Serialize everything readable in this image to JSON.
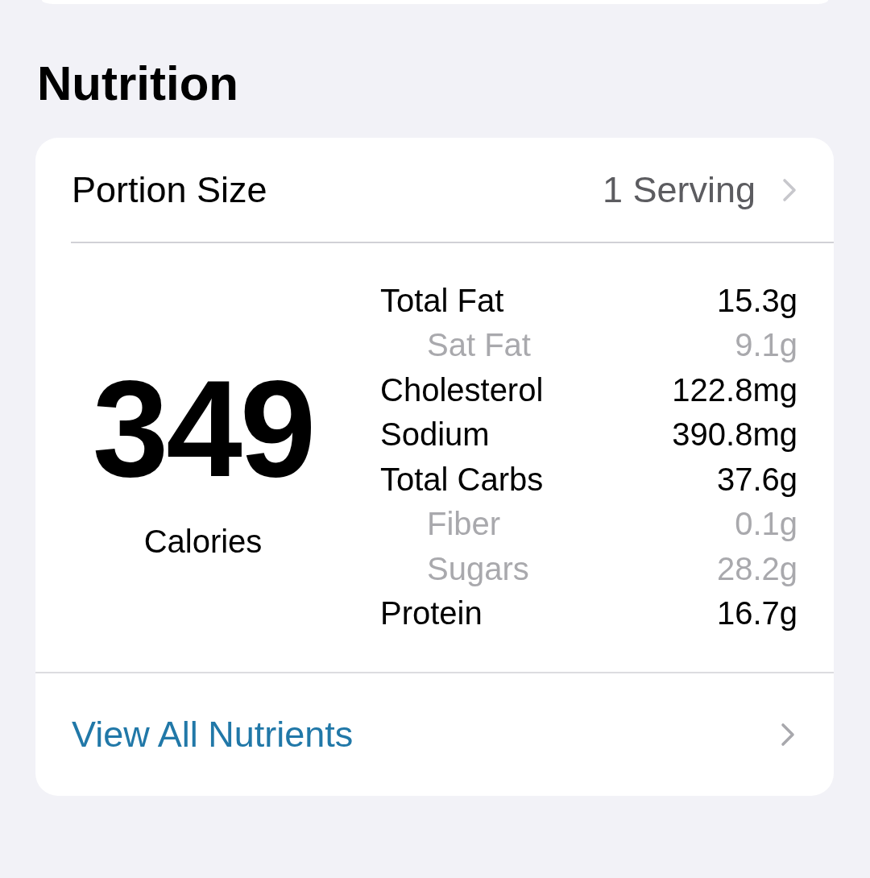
{
  "section_title": "Nutrition",
  "portion": {
    "label": "Portion Size",
    "value": "1 Serving"
  },
  "calories": {
    "value": "349",
    "label": "Calories"
  },
  "nutrients": [
    {
      "name": "Total Fat",
      "amount": "15.3g",
      "children": [
        {
          "name": "Sat Fat",
          "amount": "9.1g"
        }
      ]
    },
    {
      "name": "Cholesterol",
      "amount": "122.8mg"
    },
    {
      "name": "Sodium",
      "amount": "390.8mg"
    },
    {
      "name": "Total Carbs",
      "amount": "37.6g",
      "children": [
        {
          "name": "Fiber",
          "amount": "0.1g"
        },
        {
          "name": "Sugars",
          "amount": "28.2g"
        }
      ]
    },
    {
      "name": "Protein",
      "amount": "16.7g"
    }
  ],
  "link": {
    "label": "View All Nutrients"
  }
}
